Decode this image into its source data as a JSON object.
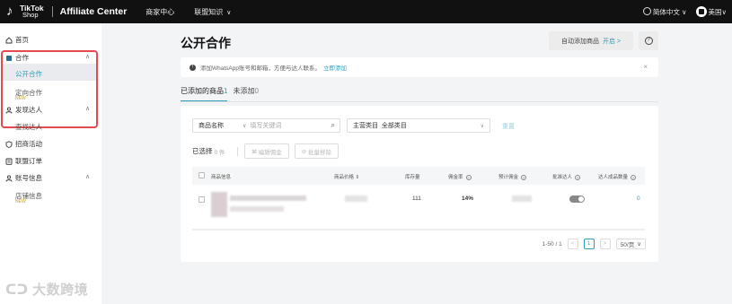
{
  "header": {
    "logo_line1": "TikTok",
    "logo_line2": "Shop",
    "app_title": "Affiliate Center",
    "nav": [
      "商家中心",
      "联盟知识"
    ],
    "language": "简体中文",
    "region": "美国"
  },
  "sidebar": {
    "home": "首页",
    "cooperation": "合作",
    "public_coop": "公开合作",
    "targeted_coop": "定向合作",
    "new_tag": "NEW",
    "discover": "发现达人",
    "find_creators": "查找达人",
    "campaigns": "招商活动",
    "orders": "联盟订单",
    "account": "账号信息",
    "store_info": "店铺信息",
    "watermark": "大数跨境"
  },
  "main": {
    "title": "公开合作",
    "auto_add_label": "自动添加商品",
    "auto_add_state": "开启 >",
    "notice_text": "添加WhatsApp账号和邮箱，方便与达人联系。",
    "notice_link": "立即添加",
    "tabs": [
      {
        "label": "已添加的商品",
        "count": "1"
      },
      {
        "label": "未添加",
        "count": "0"
      }
    ],
    "filter": {
      "field_label": "商品名称",
      "search_placeholder": "填写关键词",
      "category_label": "主营类目",
      "category_value": "全部类目",
      "reset": "重置"
    },
    "selected_label": "已选择",
    "selected_count": "0 件",
    "btn_edit_commission": "编辑佣金",
    "btn_remove": "批量移除",
    "table": {
      "headers": [
        "商品信息",
        "商品价格",
        "库存量",
        "佣金率",
        "预计佣金",
        "批准达人",
        "达人成品数量"
      ],
      "rows": [
        {
          "stock": "111",
          "commission_rate": "14%",
          "creator_count": "0"
        }
      ]
    },
    "pager": {
      "range": "1-50 / 1",
      "page": "1",
      "size": "50/页"
    }
  }
}
